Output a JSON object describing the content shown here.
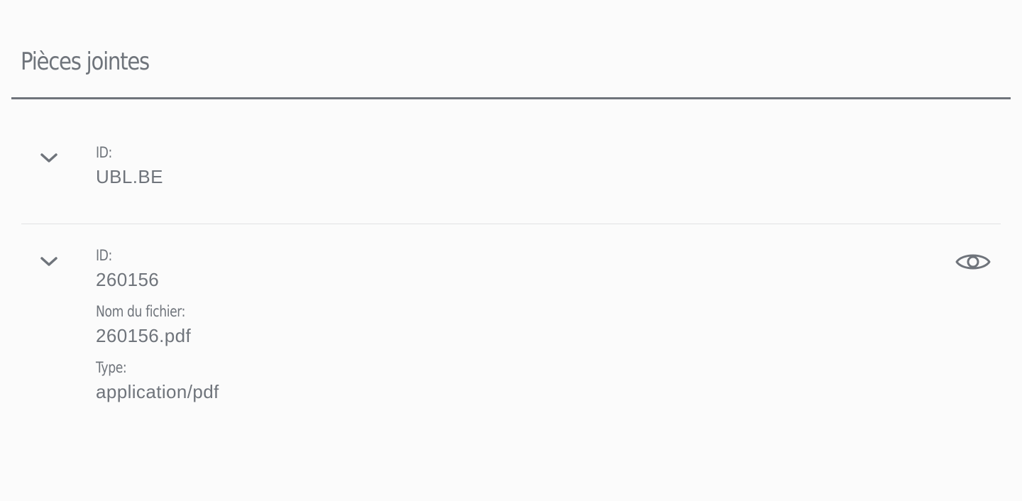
{
  "section": {
    "title": "Pièces jointes"
  },
  "attachments": [
    {
      "fields": [
        {
          "label": "ID:",
          "value": "UBL.BE"
        }
      ],
      "expand_icon": "chevron-down-icon"
    },
    {
      "fields": [
        {
          "label": "ID:",
          "value": "260156"
        },
        {
          "label": "Nom du fichier:",
          "value": "260156.pdf"
        },
        {
          "label": "Type:",
          "value": "application/pdf"
        }
      ],
      "expand_icon": "chevron-down-icon",
      "action_icon": "eye-icon"
    }
  ],
  "colors": {
    "text": "#6f747b",
    "background": "#fbfbfb",
    "divider": "#e1e2e4",
    "header_rule": "#6f747b"
  }
}
